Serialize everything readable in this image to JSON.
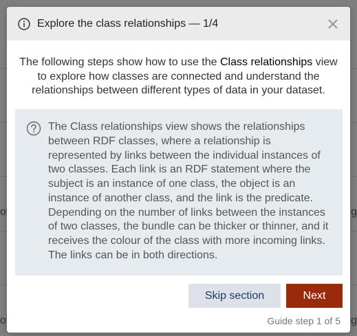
{
  "background": {
    "left_fragments": [
      "ow",
      "ov"
    ],
    "right_fragments": [
      "ng",
      "ng"
    ]
  },
  "dialog": {
    "title": "Explore the class relationships — 1/4",
    "close_label": "×",
    "intro_before": "The following steps show how to use the ",
    "intro_highlight": "Class relationships",
    "intro_after": " view to explore how classes are connected and understand the relationships between different types of data in your dataset.",
    "note_text": "The Class relationships view shows the relationships between RDF classes, where a relationship is represented by links between the individual instances of two classes. Each link is an RDF statement where the subject is an instance of one class, the object is an instance of another class, and the link is the predicate. Depending on the number of links between the instances of two classes, the bundle can be thicker or thinner, and it receives the colour of the class with more incoming links. The links can be in both directions.",
    "skip_label": "Skip section",
    "next_label": "Next",
    "step_text": "Guide step 1 of 5"
  },
  "icons": {
    "title_icon": "info-icon",
    "close_icon": "close-icon",
    "note_icon": "question-icon"
  },
  "colors": {
    "header_bg": "#ebebeb",
    "note_bg": "#e6ebf0",
    "skip_bg": "#dde2e8",
    "skip_text": "#1f3c68",
    "next_bg": "#9b2a0c",
    "next_text": "#ffffff",
    "overlay": "#7f7f7f"
  }
}
